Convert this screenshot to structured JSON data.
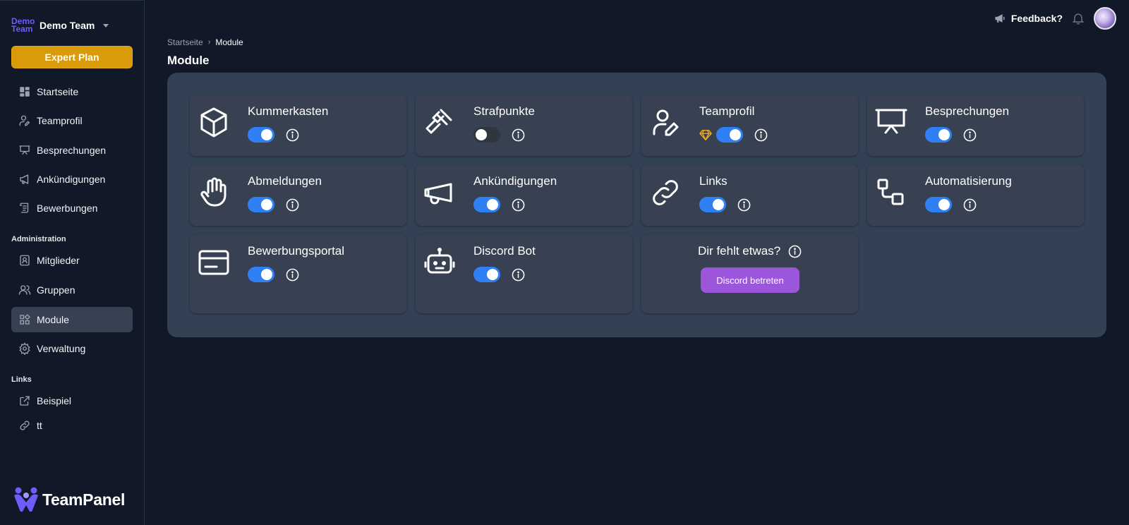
{
  "team": {
    "logo_line1": "Demo",
    "logo_line2": "Team",
    "name": "Demo Team"
  },
  "plan": {
    "label": "Expert Plan",
    "color": "#d99b0a"
  },
  "sidebar": {
    "items": [
      {
        "label": "Startseite",
        "icon": "dashboard-icon"
      },
      {
        "label": "Teamprofil",
        "icon": "user-edit-icon"
      },
      {
        "label": "Besprechungen",
        "icon": "presentation-icon"
      },
      {
        "label": "Ankündigungen",
        "icon": "megaphone-icon"
      },
      {
        "label": "Bewerbungen",
        "icon": "scroll-icon"
      }
    ],
    "admin_heading": "Administration",
    "admin_items": [
      {
        "label": "Mitglieder",
        "icon": "member-card-icon"
      },
      {
        "label": "Gruppen",
        "icon": "users-icon"
      },
      {
        "label": "Module",
        "icon": "modules-icon",
        "active": true
      },
      {
        "label": "Verwaltung",
        "icon": "gear-icon"
      }
    ],
    "links_heading": "Links",
    "links": [
      {
        "label": "Beispiel",
        "icon": "external-link-icon"
      },
      {
        "label": "tt",
        "icon": "link-icon"
      }
    ]
  },
  "brand": {
    "name": "TeamPanel"
  },
  "header": {
    "feedback_label": "Feedback?"
  },
  "breadcrumb": {
    "home": "Startseite",
    "current": "Module"
  },
  "page": {
    "title": "Module"
  },
  "modules": [
    {
      "name": "Kummerkasten",
      "icon": "box-icon",
      "enabled": true
    },
    {
      "name": "Strafpunkte",
      "icon": "gavel-icon",
      "enabled": false
    },
    {
      "name": "Teamprofil",
      "icon": "user-edit-icon",
      "enabled": true,
      "premium": true
    },
    {
      "name": "Besprechungen",
      "icon": "presentation-icon",
      "enabled": true
    },
    {
      "name": "Abmeldungen",
      "icon": "hand-icon",
      "enabled": true
    },
    {
      "name": "Ankündigungen",
      "icon": "megaphone-icon",
      "enabled": true
    },
    {
      "name": "Links",
      "icon": "link-icon",
      "enabled": true
    },
    {
      "name": "Automatisierung",
      "icon": "flow-icon",
      "enabled": true
    },
    {
      "name": "Bewerbungsportal",
      "icon": "card-icon",
      "enabled": true
    },
    {
      "name": "Discord Bot",
      "icon": "robot-icon",
      "enabled": true
    }
  ],
  "missing_card": {
    "title": "Dir fehlt etwas?",
    "button_label": "Discord betreten",
    "button_color": "#9c56db"
  },
  "colors": {
    "toggle_on": "#2f80f5",
    "panel": "#334155",
    "background": "#111827"
  }
}
